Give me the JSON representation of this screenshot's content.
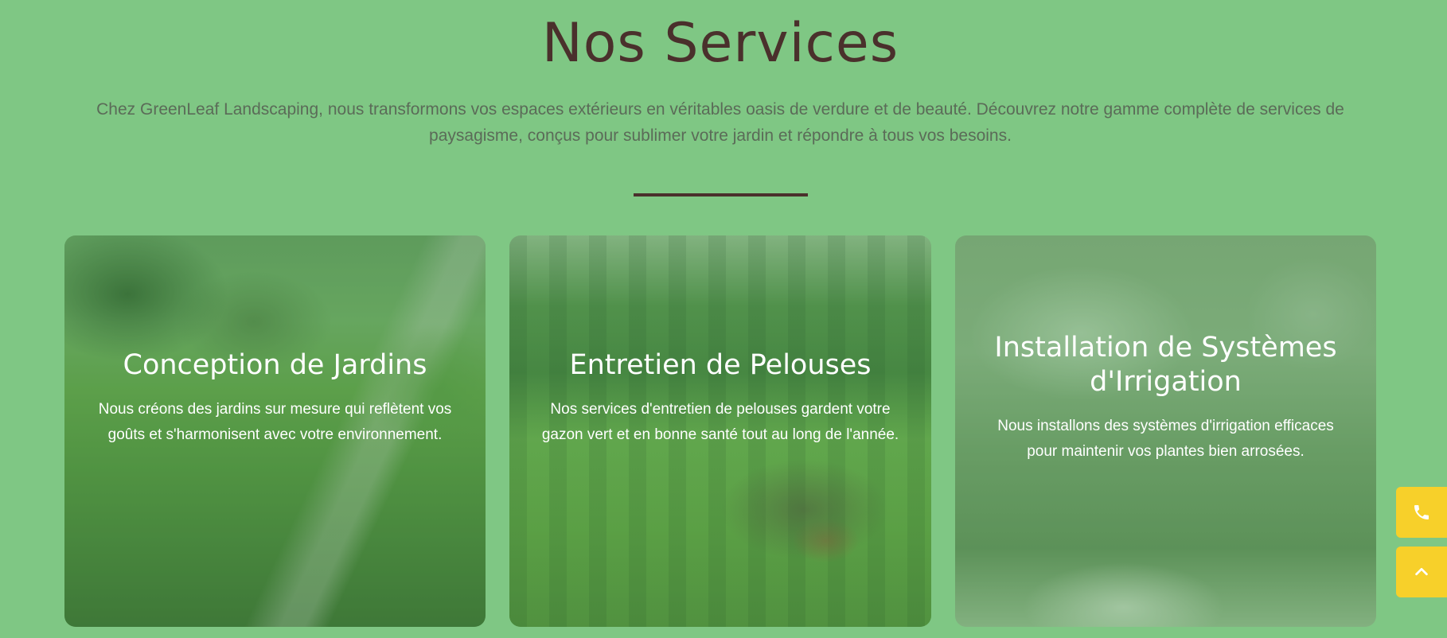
{
  "section": {
    "title": "Nos Services",
    "intro": "Chez GreenLeaf Landscaping, nous transformons vos espaces extérieurs en véritables oasis de verdure et de beauté. Découvrez notre gamme complète de services de paysagisme, conçus pour sublimer votre jardin et répondre à tous vos besoins."
  },
  "services": [
    {
      "title": "Conception de Jardins",
      "description": "Nous créons des jardins sur mesure qui reflètent vos goûts et s'harmonisent avec votre environnement."
    },
    {
      "title": "Entretien de Pelouses",
      "description": "Nos services d'entretien de pelouses gardent votre gazon vert et en bonne santé tout au long de l'année."
    },
    {
      "title": "Installation de Systèmes d'Irrigation",
      "description": "Nous installons des systèmes d'irrigation efficaces pour maintenir vos plantes bien arrosées."
    }
  ],
  "floating_buttons": {
    "phone_icon": "phone-icon",
    "top_icon": "chevron-up-icon"
  },
  "colors": {
    "background": "#7fc784",
    "title": "#4a302c",
    "accent_button": "#f7d02a"
  }
}
